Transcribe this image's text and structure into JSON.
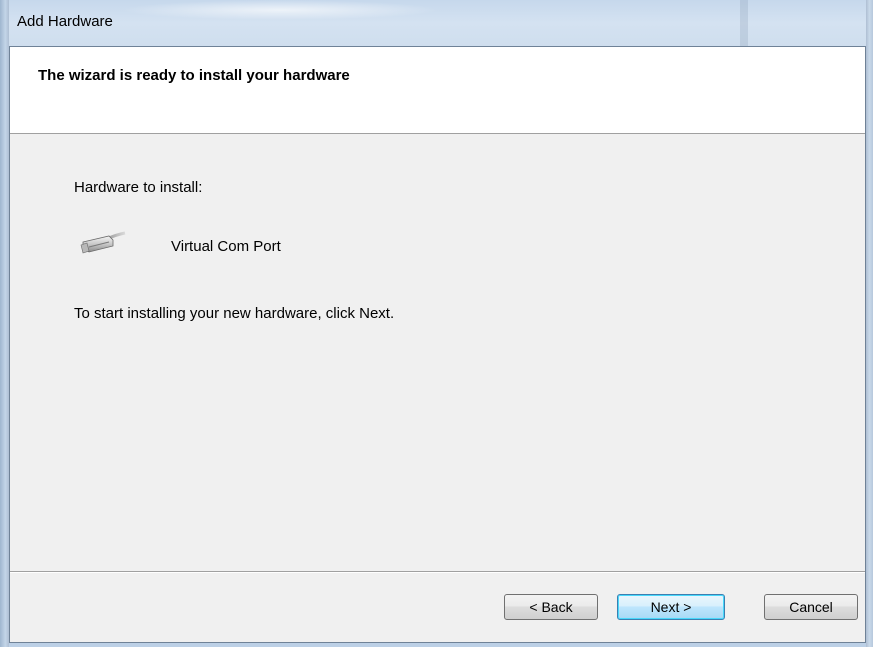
{
  "window": {
    "title": "Add Hardware"
  },
  "header": {
    "title": "The wizard is ready to install your hardware"
  },
  "content": {
    "hardware_label": "Hardware to install:",
    "device": {
      "icon": "serial-port-icon",
      "name": "Virtual Com Port"
    },
    "instruction": "To start installing your new hardware, click Next."
  },
  "buttons": {
    "back": "< Back",
    "next": "Next >",
    "cancel": "Cancel"
  },
  "colors": {
    "frame": "#bcd0e6",
    "client_bg": "#f0f0f0",
    "header_bg": "#ffffff",
    "default_button_border": "#3c7fb1"
  }
}
